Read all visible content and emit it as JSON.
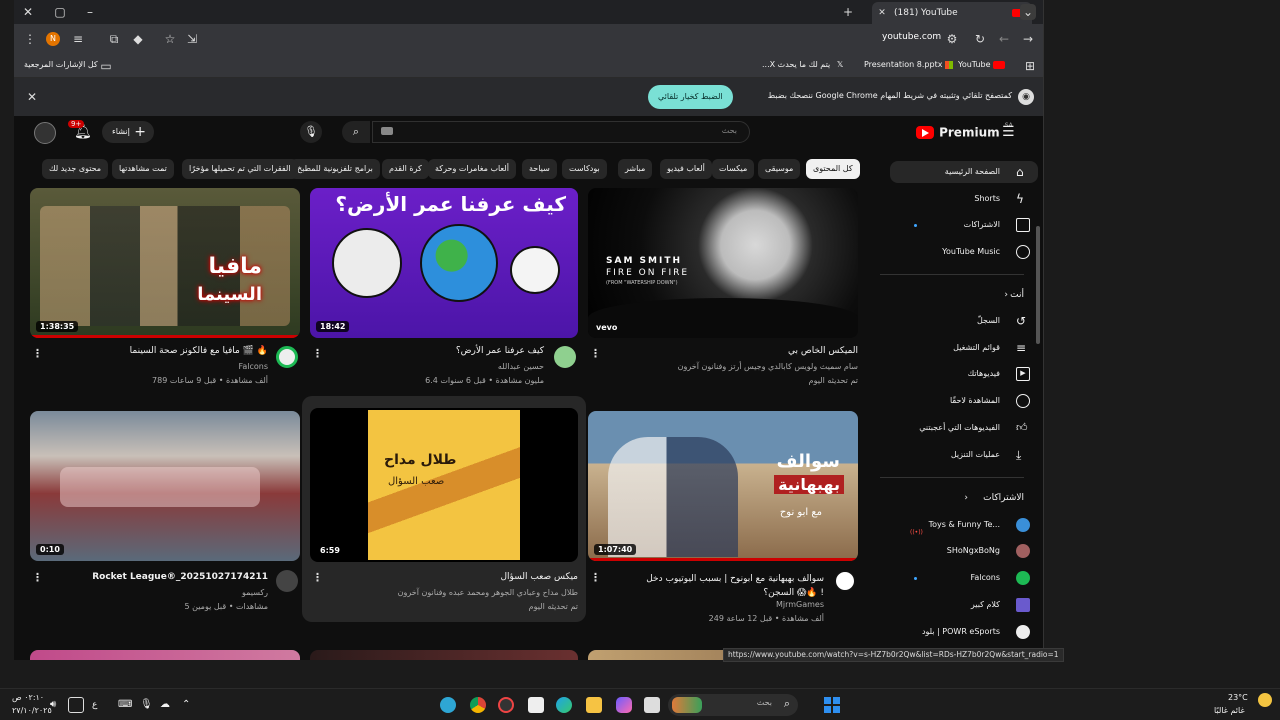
{
  "browser": {
    "tab_title": "(181) YouTube",
    "url": "youtube.com",
    "status_url": "https://www.youtube.com/watch?v=s-HZ7b0r2Qw&list=RDs-HZ7b0r2Qw&start_radio=1"
  },
  "bookmarks": [
    {
      "label": "YouTube",
      "icon": "youtube-icon"
    },
    {
      "label": "Presentation 8.pptx",
      "icon": "office-icon"
    },
    {
      "label": "...X يتم لك ما يحدث",
      "icon": "x-icon"
    }
  ],
  "bookmarks_right": "كل الإشارات المرجعية",
  "infobar": {
    "message": "ننصحك بضبط Google Chrome كمتصفح تلقائي وتثبيته في شريط المهام",
    "button": "الضبط كخيار تلقائي"
  },
  "youtube": {
    "logo": "Premium",
    "logo_region": "SA",
    "search_placeholder": "بحث",
    "create_label": "إنشاء",
    "notif_count": "9+",
    "chips": [
      "كل المحتوى",
      "موسيقى",
      "ميكسات",
      "ألعاب فيديو",
      "مباشر",
      "بودكاست",
      "سياحة",
      "ألعاب مغامرات وحركة",
      "كرة القدم",
      "برامج تلفزيونية للمطبخ",
      "الفقرات التي تم تحميلها مؤخرًا",
      "تمت مشاهدتها",
      "محتوى جديد لك"
    ],
    "sidebar": {
      "main": [
        {
          "label": "الصفحة الرئيسية",
          "icon": "home-icon"
        },
        {
          "label": "Shorts",
          "icon": "shorts-icon"
        },
        {
          "label": "الاشتراكات",
          "icon": "subscriptions-icon"
        },
        {
          "label": "YouTube Music",
          "icon": "music-icon"
        }
      ],
      "you_header": "أنت",
      "you": [
        {
          "label": "السجلّ",
          "icon": "history-icon"
        },
        {
          "label": "قوائم التشغيل",
          "icon": "playlist-icon"
        },
        {
          "label": "فيديوهاتك",
          "icon": "video-icon"
        },
        {
          "label": "المشاهدة لاحقًا",
          "icon": "clock-icon"
        },
        {
          "label": "الفيديوهات التي أعجبتني",
          "icon": "like-icon"
        },
        {
          "label": "عمليات التنزيل",
          "icon": "download-icon"
        }
      ],
      "subs_header": "الاشتراكات",
      "subs": [
        {
          "label": "Toys & Funny Te...",
          "color": "#3a8fd8"
        },
        {
          "label": "SHoNgxBoNg",
          "color": "#a06060"
        },
        {
          "label": "Falcons",
          "color": "#1db954"
        },
        {
          "label": "كلام كبير",
          "color": "#6a5acd"
        },
        {
          "label": "بلود | POWR eSports",
          "color": "#eeeeee"
        }
      ]
    },
    "videos": [
      {
        "title": "الميكس الخاص بي",
        "channel": "سام سميث ولويس كابالدي وجيس أرتز وفنانون آخرون",
        "meta": "تم تحديثه اليوم",
        "duration": "",
        "thumb_text": "SAM SMITH",
        "thumb_sub": "FIRE ON FIRE",
        "thumb_sub2": "(FROM \"WATERSHIP DOWN\")",
        "badge": "vevo"
      },
      {
        "title": "كيف عرفنا عمر الأرض؟",
        "channel": "حسين عبدالله",
        "meta": "6.4 مليون مشاهدة • قبل 6 سنوات",
        "duration": "18:42",
        "thumb_text": "كيف عرفنا عمر الأرض؟"
      },
      {
        "title": "مافيا مع فالكونز صحة السينما 🎬 🔥",
        "channel": "Falcons",
        "meta": "789 ألف مشاهدة • قبل 9 ساعات",
        "duration": "1:38:35",
        "thumb_text": "مافيا",
        "thumb_sub": "السينما"
      },
      {
        "title": "سوالف بهبهانية مع ابونوح | بسبب اليوتيوب دخل السجن؟ 😱🔥 !",
        "channel": "MjrmGames",
        "meta": "249 ألف مشاهدة • قبل 12 ساعة",
        "duration": "1:07:40",
        "thumb_text": "سوالف",
        "thumb_sub": "بهبهانية",
        "thumb_sub2": "مع ابو نوح"
      },
      {
        "title": "ميكس صعب السؤال",
        "channel": "طلال مداح وعبادي الجوهر ومحمد عبده وفنانون آخرون",
        "meta": "تم تحديثه اليوم",
        "duration": "6:59",
        "thumb_text": "طلال مداح",
        "thumb_sub": "صعب السؤال"
      },
      {
        "title": "Rocket League®_20251027174211",
        "channel": "ﺭﻛﺴﻴﻤﻮ",
        "meta": "5 مشاهدات • قبل يومين",
        "duration": "0:10"
      }
    ]
  },
  "taskbar": {
    "time": "٠٢:١٠ ص",
    "date": "٢٧/١٠/٢٠٢٥",
    "weather_temp": "23°C",
    "weather_desc": "غائم غالبًا",
    "search_placeholder": "بحث"
  }
}
